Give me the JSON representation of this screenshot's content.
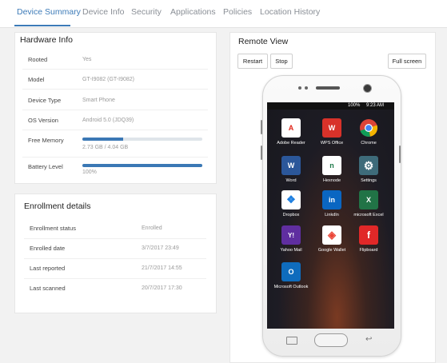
{
  "tabs": [
    {
      "label": "Device Summary",
      "active": true
    },
    {
      "label": "Device Info"
    },
    {
      "label": "Security"
    },
    {
      "label": "Applications"
    },
    {
      "label": "Policies"
    },
    {
      "label": "Location History"
    }
  ],
  "hardware": {
    "title": "Hardware Info",
    "rows": [
      {
        "label": "Rooted",
        "value": "Yes"
      },
      {
        "label": "Model",
        "value": "GT-I9082 (GT-I9082)"
      },
      {
        "label": "Device Type",
        "value": "Smart Phone"
      },
      {
        "label": "OS Version",
        "value": "Android 5.0 (JDQ39)"
      },
      {
        "label": "Free Memory",
        "value": "2.73 GB / 4.04 GB",
        "fraction": 0.34
      },
      {
        "label": "Battery Level",
        "value": "100%",
        "fraction": 1.0
      }
    ]
  },
  "enrollment": {
    "title": "Enrollment details",
    "rows": [
      {
        "label": "Enrollment status",
        "value": "Enrolled"
      },
      {
        "label": "Enrolled date",
        "value": "3/7/2017 23:49"
      },
      {
        "label": "Last reported",
        "value": "21/7/2017 14:55"
      },
      {
        "label": "Last scanned",
        "value": "20/7/2017 17:30"
      }
    ]
  },
  "remote": {
    "title": "Remote View",
    "restart": "Restart",
    "stop": "Stop",
    "fullscreen": "Full screen",
    "status": {
      "battery": "100%",
      "time": "9:23 AM"
    },
    "apps": [
      {
        "label": "Adobe Reader",
        "icon": "adobe-reader-icon",
        "glyph": "A",
        "color": "#e0271b",
        "bg": "#ffffff"
      },
      {
        "label": "WPS Office",
        "icon": "wps-office-icon",
        "glyph": "W",
        "color": "#ffffff",
        "bg": "#d8322a"
      },
      {
        "label": "Chrome",
        "icon": "chrome-icon",
        "glyph": "",
        "color": "#ffffff",
        "bg": "transparent"
      },
      {
        "label": "Word",
        "icon": "word-icon",
        "glyph": "W",
        "color": "#ffffff",
        "bg": "#2b579a"
      },
      {
        "label": "Hexnode",
        "icon": "hexnode-icon",
        "glyph": "n",
        "color": "#1f7a4a",
        "bg": "#ffffff"
      },
      {
        "label": "Settings",
        "icon": "settings-icon",
        "glyph": "⚙",
        "color": "#ffffff",
        "bg": "#3e6b7a"
      },
      {
        "label": "Dropbox",
        "icon": "dropbox-icon",
        "glyph": "❖",
        "color": "#1e7fe0",
        "bg": "#ffffff"
      },
      {
        "label": "LinkdIn",
        "icon": "linkedin-icon",
        "glyph": "in",
        "color": "#ffffff",
        "bg": "#0a66c2"
      },
      {
        "label": "microsoft Excel",
        "icon": "excel-icon",
        "glyph": "X",
        "color": "#ffffff",
        "bg": "#217346"
      },
      {
        "label": "Yahoo Mail",
        "icon": "yahoo-mail-icon",
        "glyph": "Y!",
        "color": "#ffffff",
        "bg": "#5f2ea0"
      },
      {
        "label": "Google Wallet",
        "icon": "google-wallet-icon",
        "glyph": "◈",
        "color": "#ea4335",
        "bg": "#ffffff"
      },
      {
        "label": "Flipboard",
        "icon": "flipboard-icon",
        "glyph": "f",
        "color": "#ffffff",
        "bg": "#e12828"
      },
      {
        "label": "Microsoft Outlook",
        "icon": "outlook-icon",
        "glyph": "O",
        "color": "#ffffff",
        "bg": "#0f6cbd"
      }
    ]
  }
}
